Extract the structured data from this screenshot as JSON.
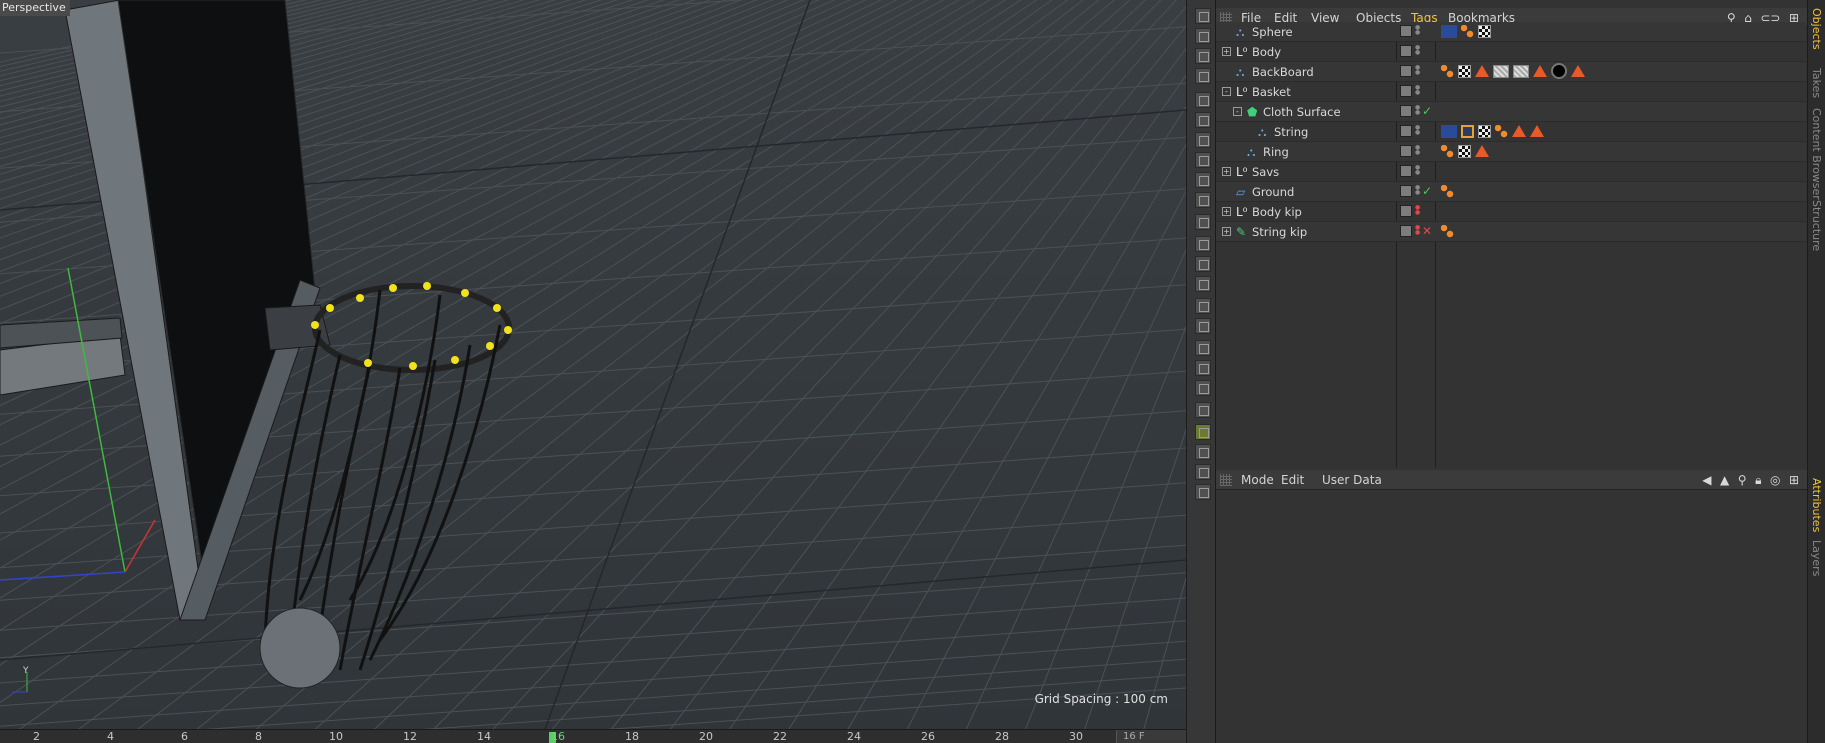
{
  "viewport": {
    "label": "Perspective",
    "grid_spacing": "Grid Spacing : 100 cm",
    "timeline_ticks": [
      "2",
      "4",
      "6",
      "8",
      "10",
      "12",
      "14",
      "16",
      "18",
      "20",
      "22",
      "24",
      "26",
      "28",
      "30"
    ],
    "current_frame": "16",
    "frame_field": "16 F"
  },
  "object_manager": {
    "menus": [
      "File",
      "Edit",
      "View",
      "Objects",
      "Tags",
      "Bookmarks"
    ],
    "active_menu": "Tags",
    "objects": [
      {
        "name": "Sphere",
        "depth": 0,
        "expand": "",
        "icon": "polygon-object-icon",
        "state": "",
        "dots": "grey"
      },
      {
        "name": "Body",
        "depth": 0,
        "expand": "+",
        "icon": "null-object-icon",
        "state": "",
        "dots": "grey"
      },
      {
        "name": "BackBoard",
        "depth": 0,
        "expand": "",
        "icon": "polygon-object-icon",
        "state": "",
        "dots": "grey"
      },
      {
        "name": "Basket",
        "depth": 0,
        "expand": "-",
        "icon": "null-object-icon",
        "state": "",
        "dots": "grey"
      },
      {
        "name": "Cloth Surface",
        "depth": 1,
        "expand": "-",
        "icon": "cloth-surface-icon",
        "state": "✓",
        "dots": "grey"
      },
      {
        "name": "String",
        "depth": 2,
        "expand": "",
        "icon": "polygon-object-icon",
        "state": "",
        "dots": "grey"
      },
      {
        "name": "Ring",
        "depth": 1,
        "expand": "",
        "icon": "polygon-object-icon",
        "state": "",
        "dots": "grey"
      },
      {
        "name": "Savs",
        "depth": 0,
        "expand": "+",
        "icon": "null-object-icon",
        "state": "",
        "dots": "grey"
      },
      {
        "name": "Ground",
        "depth": 0,
        "expand": "",
        "icon": "plane-object-icon",
        "state": "✓",
        "dots": "grey"
      },
      {
        "name": "Body kip",
        "depth": 0,
        "expand": "+",
        "icon": "null-object-icon",
        "state": "",
        "dots": "red"
      },
      {
        "name": "String kip",
        "depth": 0,
        "expand": "+",
        "icon": "deformer-icon",
        "state": "✕",
        "dots": "red"
      }
    ]
  },
  "attribute_manager": {
    "menus": [
      "Mode",
      "Edit",
      "User Data"
    ]
  },
  "side_tabs": {
    "top": [
      "Objects",
      "Takes",
      "Content Browser",
      "Structure"
    ],
    "bottom": [
      "Attributes",
      "Layers"
    ]
  }
}
